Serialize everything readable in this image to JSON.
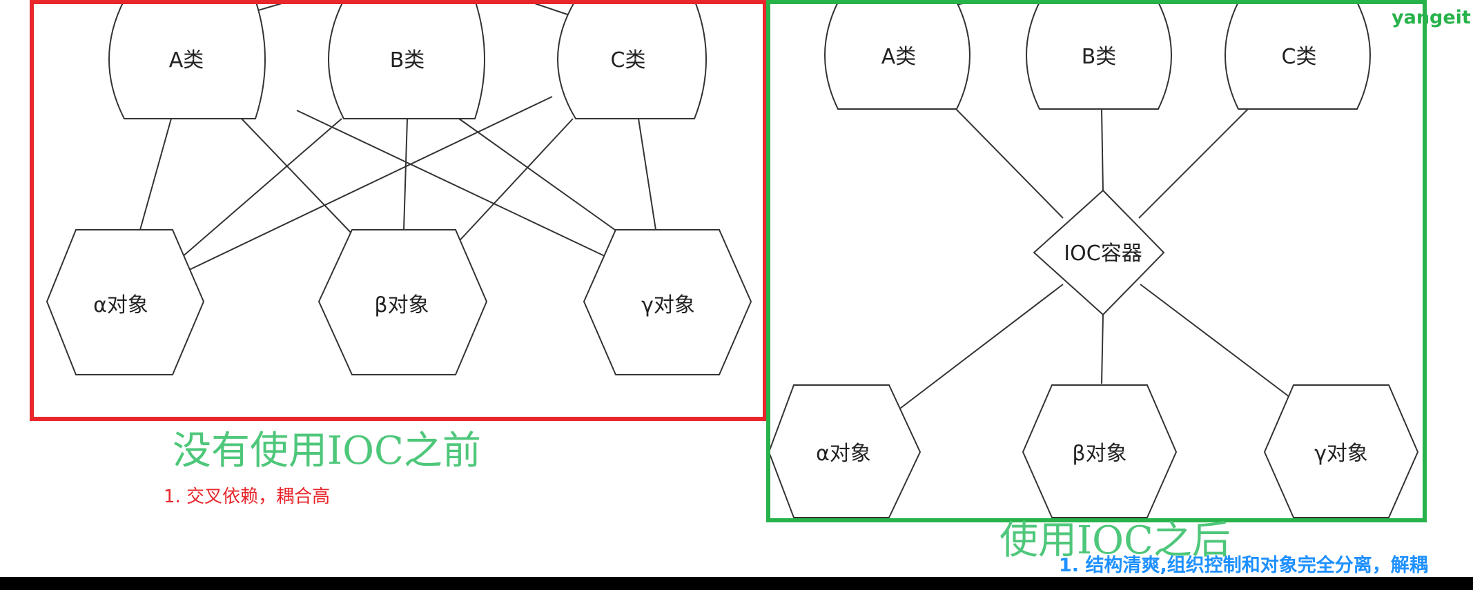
{
  "colors": {
    "left_frame": "#e8262b",
    "right_frame": "#27b24a",
    "title_green": "#4ec77a",
    "blue_text": "#1e90ff",
    "bottom_bar": "#000000",
    "stroke": "#333333"
  },
  "watermark": "yangeit",
  "left": {
    "classes": [
      "A类",
      "B类",
      "C类"
    ],
    "objects": [
      "α对象",
      "β对象",
      "γ对象"
    ],
    "title": "没有使用IOC之前",
    "note": "1. 交叉依赖，耦合高"
  },
  "right": {
    "classes": [
      "A类",
      "B类",
      "C类"
    ],
    "container": "IOC容器",
    "objects": [
      "α对象",
      "β对象",
      "γ对象"
    ],
    "title": "使用IOC之后",
    "note": "1. 结构清爽,组织控制和对象完全分离，解耦"
  }
}
